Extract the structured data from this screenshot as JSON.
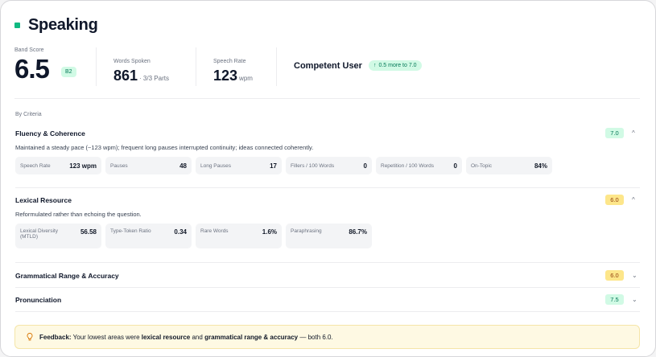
{
  "header": {
    "title": "Speaking",
    "accent": "#10b981"
  },
  "stats": {
    "band_label": "Band Score",
    "band_value": "6.5",
    "band_badge": "B2",
    "words_label": "Words Spoken",
    "words_value": "861",
    "words_sub": "· 3/3 Parts",
    "rate_label": "Speech Rate",
    "rate_value": "123",
    "rate_unit": "wpm",
    "level": "Competent User",
    "level_pill": "0.5 more to 7.0"
  },
  "criteria_label": "By Criteria",
  "criteria": [
    {
      "title": "Fluency & Coherence",
      "score": "7.0",
      "color": "green",
      "expanded": true,
      "description": "Maintained a steady pace (~123 wpm); frequent long pauses interrupted continuity; ideas connected coherently.",
      "metrics": [
        {
          "label": "Speech Rate",
          "value": "123 wpm"
        },
        {
          "label": "Pauses",
          "value": "48"
        },
        {
          "label": "Long Pauses",
          "value": "17"
        },
        {
          "label": "Fillers / 100 Words",
          "value": "0"
        },
        {
          "label": "Repetition / 100 Words",
          "value": "0"
        },
        {
          "label": "On-Topic",
          "value": "84%"
        }
      ]
    },
    {
      "title": "Lexical Resource",
      "score": "6.0",
      "color": "amber",
      "expanded": true,
      "description": "Reformulated rather than echoing the question.",
      "metrics": [
        {
          "label": "Lexical Diversity (MTLD)",
          "value": "56.58"
        },
        {
          "label": "Type-Token Ratio",
          "value": "0.34"
        },
        {
          "label": "Rare Words",
          "value": "1.6%"
        },
        {
          "label": "Paraphrasing",
          "value": "86.7%"
        }
      ]
    },
    {
      "title": "Grammatical Range & Accuracy",
      "score": "6.0",
      "color": "amber",
      "expanded": false
    },
    {
      "title": "Pronunciation",
      "score": "7.5",
      "color": "green",
      "expanded": false
    }
  ],
  "feedback": {
    "label": "Feedback:",
    "text_1": "Your lowest areas were",
    "bold_1": "lexical resource",
    "text_2": "and",
    "bold_2": "grammatical range & accuracy",
    "text_3": "— both 6.0."
  }
}
